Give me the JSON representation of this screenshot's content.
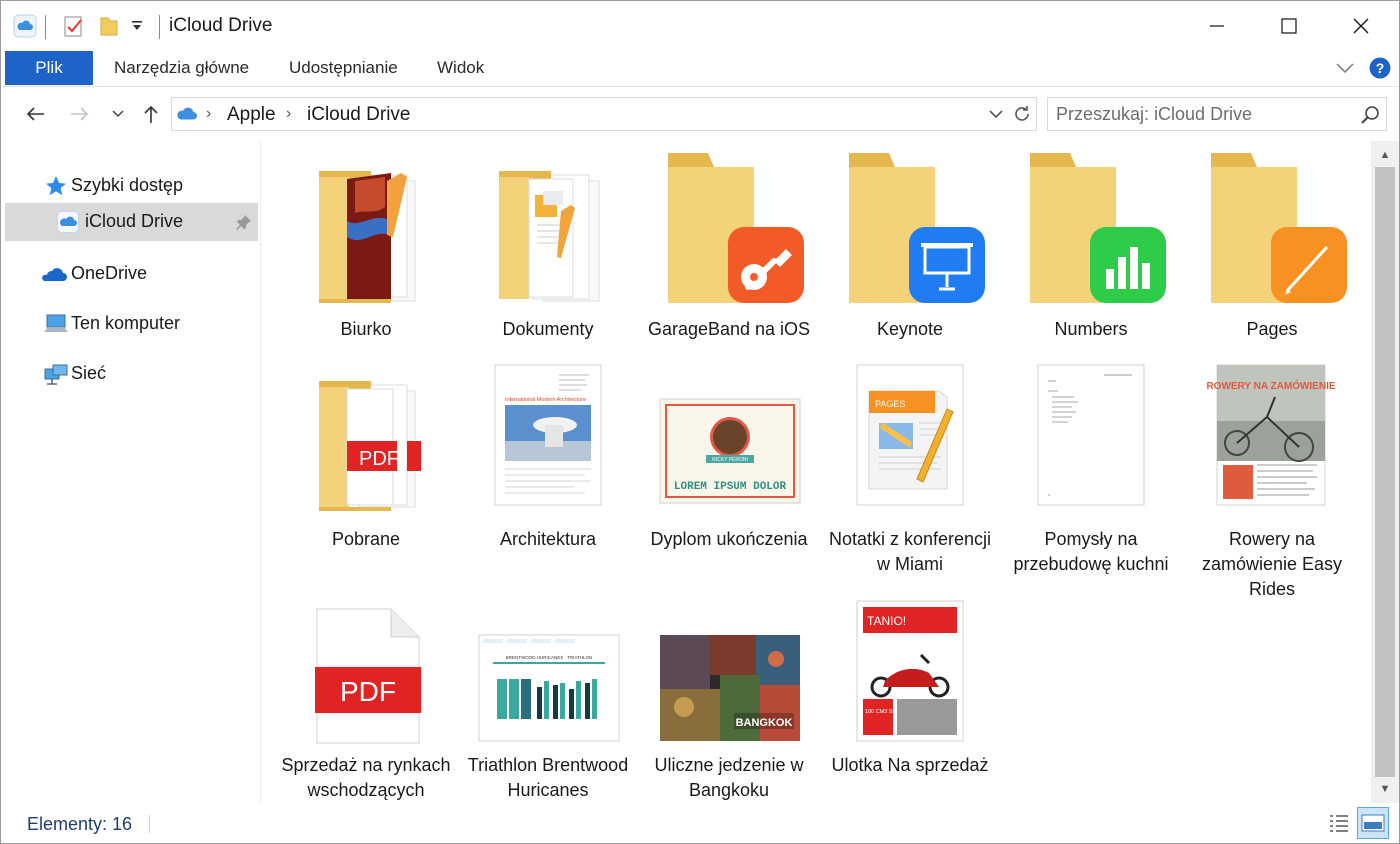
{
  "window": {
    "title": "iCloud Drive",
    "minimize_label": "Minimalizuj",
    "maximize_label": "Maksymalizuj",
    "close_label": "Zamknij"
  },
  "ribbon": {
    "tabs": [
      {
        "label": "Plik",
        "active": true
      },
      {
        "label": "Narzędzia główne"
      },
      {
        "label": "Udostępnianie"
      },
      {
        "label": "Widok"
      }
    ]
  },
  "address": {
    "breadcrumb": [
      "Apple",
      "iCloud Drive"
    ],
    "search_placeholder": "Przeszukaj: iCloud Drive"
  },
  "sidebar": {
    "items": [
      {
        "label": "Szybki dostęp",
        "icon": "star-icon"
      },
      {
        "label": "iCloud Drive",
        "icon": "icloud-icon",
        "selected": true,
        "pinned": true
      },
      {
        "label": "OneDrive",
        "icon": "onedrive-icon"
      },
      {
        "label": "Ten komputer",
        "icon": "computer-icon"
      },
      {
        "label": "Sieć",
        "icon": "network-icon"
      }
    ]
  },
  "files": [
    {
      "name": "Biurko",
      "kind": "folder-doc"
    },
    {
      "name": "Dokumenty",
      "kind": "folder-doc"
    },
    {
      "name": "GarageBand na iOS",
      "kind": "app-folder",
      "app_color": "#f25a28"
    },
    {
      "name": "Keynote",
      "kind": "app-folder",
      "app_color": "#1f7cf3"
    },
    {
      "name": "Numbers",
      "kind": "app-folder",
      "app_color": "#2ecc48"
    },
    {
      "name": "Pages",
      "kind": "app-folder",
      "app_color": "#f79121"
    },
    {
      "name": "Pobrane",
      "kind": "folder-pdf",
      "pdf_text": "PDF"
    },
    {
      "name": "Architektura",
      "kind": "doc",
      "doc_title": "International Modern Architecture"
    },
    {
      "name": "Dyplom ukończenia",
      "kind": "certificate",
      "cert_text": "LOREM IPSUM DOLOR",
      "cert_badge": "RICKY PERONI"
    },
    {
      "name": "Notatki z konferencji w Miami",
      "kind": "pages-doc",
      "badge": "PAGES"
    },
    {
      "name": "Pomysły na przebudowę kuchni",
      "kind": "plain-doc"
    },
    {
      "name": "Rowery na zamówienie Easy Rides",
      "kind": "bike-doc",
      "headline": "ROWERY NA ZAMÓWIENIE"
    },
    {
      "name": "Sprzedaż na rynkach wschodzących",
      "kind": "pdf",
      "pdf_text": "PDF"
    },
    {
      "name": "Triathlon Brentwood Huricanes",
      "kind": "sheet",
      "sheet_title": "BRENTWOOD HURICANES · TRIATHLON"
    },
    {
      "name": "Uliczne jedzenie w Bangkoku",
      "kind": "keynote-photo",
      "caption": "BANGKOK"
    },
    {
      "name": "Ulotka Na sprzedaż",
      "kind": "flyer",
      "headline": "TANIO!",
      "details": "100 CM3 SKUTER 1200 Zł"
    }
  ],
  "status": {
    "items_count": "Elementy: 16"
  },
  "colors": {
    "accent": "#1e64c8",
    "folder": "#f3d27a",
    "folder_dark": "#e5b84f",
    "selected_bg": "#d9d9d9"
  }
}
